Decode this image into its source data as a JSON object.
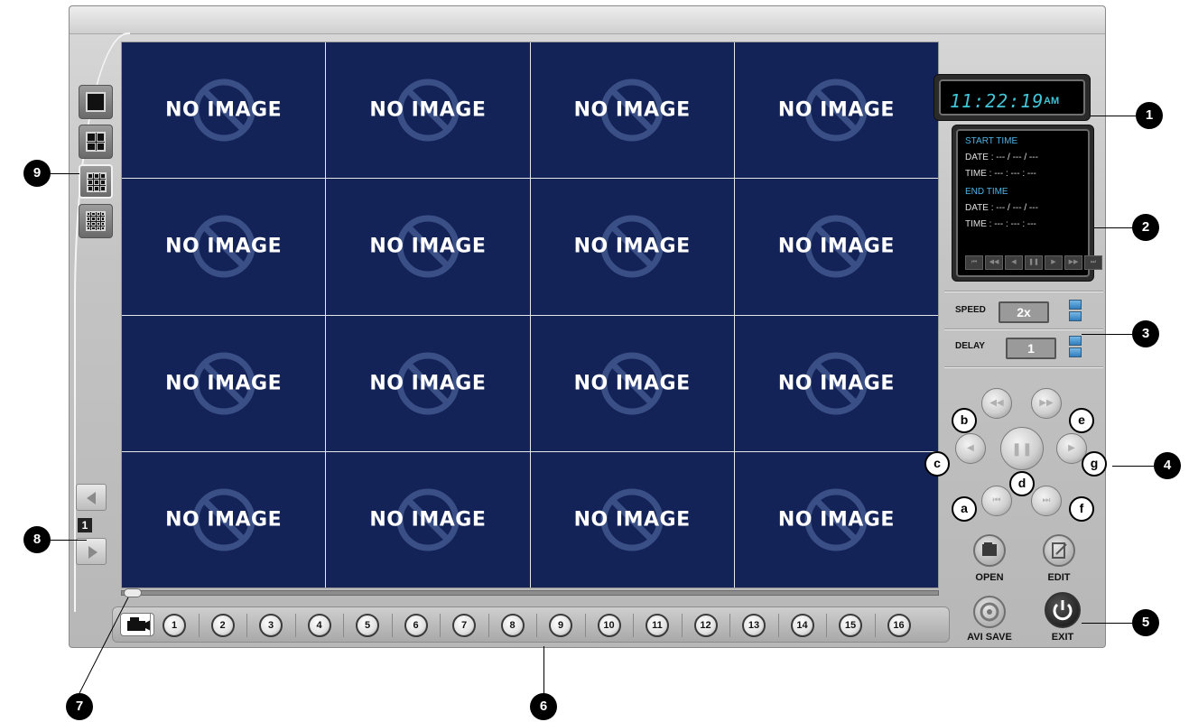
{
  "clock": {
    "time": "11:22:19",
    "ampm": "AM"
  },
  "info": {
    "start_head": "START TIME",
    "start_date": "DATE : --- / --- / ---",
    "start_time": "TIME : --- : --- : ---",
    "end_head": "END TIME",
    "end_date": "DATE : --- / --- / ---",
    "end_time": "TIME : --- : --- : ---"
  },
  "speed": {
    "label": "SPEED",
    "value": "2x"
  },
  "delay": {
    "label": "DELAY",
    "value": "1"
  },
  "grid": {
    "cell_text": "NO IMAGE",
    "cell_bg": "#132357"
  },
  "page_number": "1",
  "channels": [
    "1",
    "2",
    "3",
    "4",
    "5",
    "6",
    "7",
    "8",
    "9",
    "10",
    "11",
    "12",
    "13",
    "14",
    "15",
    "16"
  ],
  "functions": {
    "open": "OPEN",
    "edit": "EDIT",
    "avi_save": "AVI SAVE",
    "exit": "EXIT"
  },
  "callouts": [
    "1",
    "2",
    "3",
    "4",
    "5",
    "6",
    "7",
    "8",
    "9"
  ],
  "letters": {
    "a": "a",
    "b": "b",
    "c": "c",
    "d": "d",
    "e": "e",
    "f": "f",
    "g": "g"
  }
}
